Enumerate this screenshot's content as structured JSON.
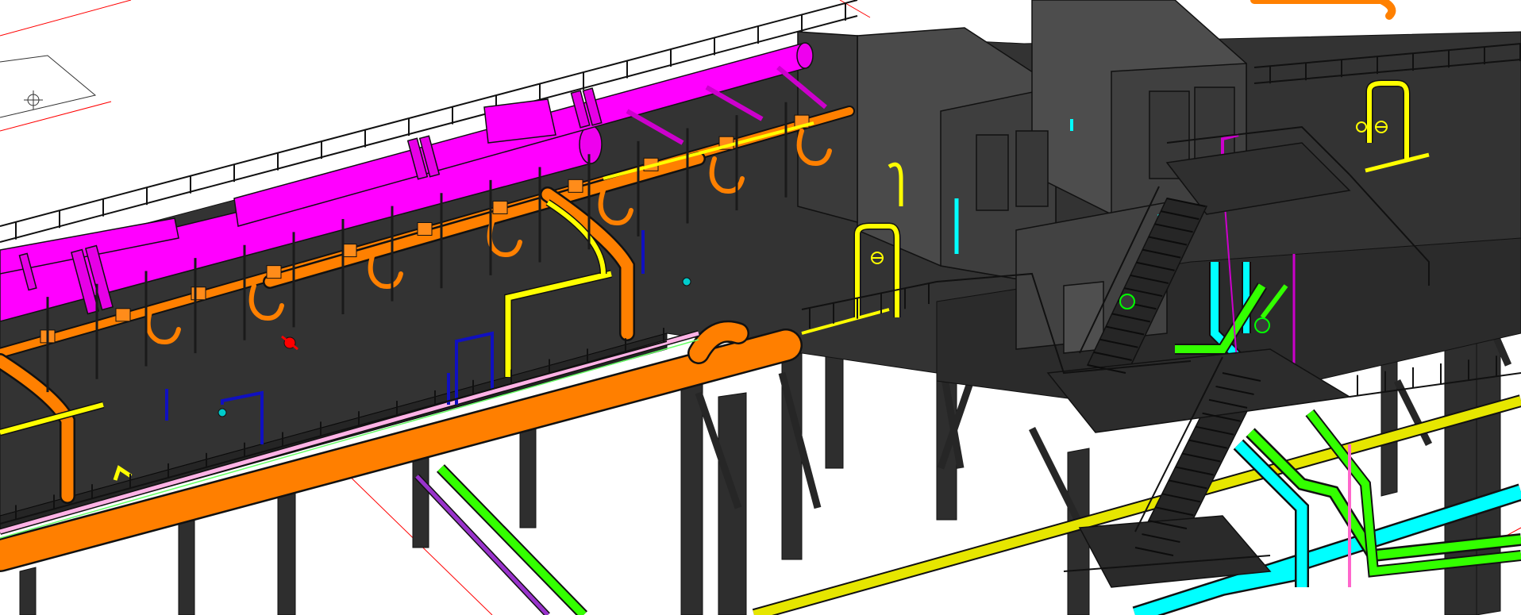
{
  "viewport": {
    "background": "#ffffff"
  },
  "colors": {
    "structure": "#3a3a3a",
    "structure_dark": "#262626",
    "structure_edge": "#111111",
    "deck": "#303030",
    "equipment": "#454545",
    "pipe_magenta": "#ff00ff",
    "pipe_orange": "#ff7f00",
    "pipe_yellow": "#ffff00",
    "pipe_green": "#00ff00",
    "pipe_cyan": "#00ffff",
    "pipe_blue": "#0000cc",
    "pipe_pink": "#ffaaee",
    "pipe_purple": "#9933cc",
    "gridline_red": "#ff0000",
    "valve_red": "#ff0000"
  },
  "icons": {
    "valve": "valve-icon",
    "flange": "flange-icon"
  }
}
